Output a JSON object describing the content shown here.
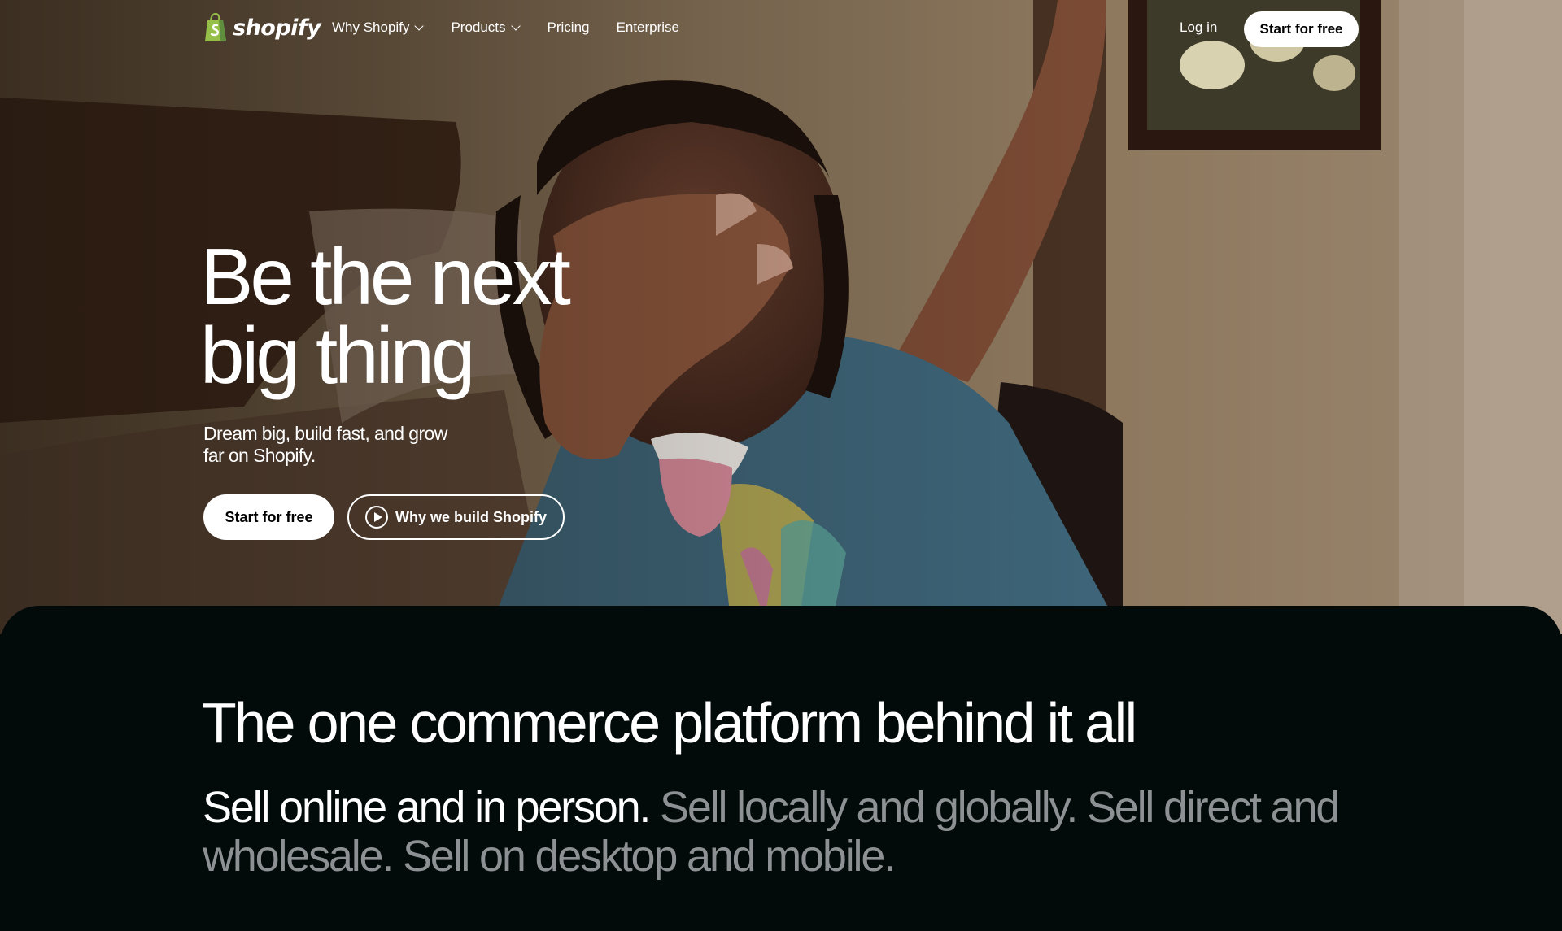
{
  "nav": {
    "brand": "shopify",
    "links": [
      {
        "label": "Why Shopify",
        "has_dropdown": true
      },
      {
        "label": "Products",
        "has_dropdown": true
      },
      {
        "label": "Pricing",
        "has_dropdown": false
      },
      {
        "label": "Enterprise",
        "has_dropdown": false
      }
    ],
    "login": "Log in",
    "cta": "Start for free"
  },
  "hero": {
    "title_line1": "Be the next",
    "title_line2": "big thing",
    "subtitle": "Dream big, build fast, and grow far on Shopify.",
    "primary_button": "Start for free",
    "secondary_button": "Why we build Shopify"
  },
  "platform": {
    "heading": "The one commerce platform behind it all",
    "lead_strong": "Sell online and in person.",
    "lead_muted": " Sell locally and globally. Sell direct and wholesale. Sell on desktop and mobile."
  },
  "colors": {
    "brand_green": "#95bf47",
    "dark_background": "#020a0a",
    "muted_text": "#8d9193"
  },
  "icons": [
    "shopify-bag-icon",
    "chevron-down-icon",
    "play-icon"
  ]
}
